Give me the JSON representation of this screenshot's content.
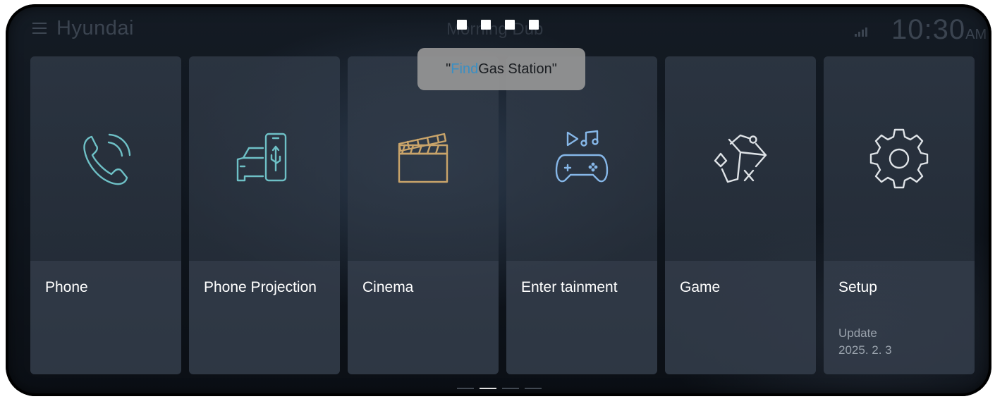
{
  "topbar": {
    "brand": "Hyundai",
    "center_text": "Morning Dub",
    "clock_time": "10:30",
    "clock_ampm": "AM",
    "signal_label": "Rall"
  },
  "voice": {
    "quote_open": "\"",
    "highlight": "Find",
    "rest": " Gas Station ",
    "quote_close": "\""
  },
  "cards": [
    {
      "label": "Phone",
      "icon": "phone-call-icon",
      "color": "#6ec0c6"
    },
    {
      "label": "Phone Projection",
      "icon": "phone-projection-icon",
      "color": "#6ec0c6"
    },
    {
      "label": "Cinema",
      "icon": "clapperboard-icon",
      "color": "#c9a46a"
    },
    {
      "label": "Enter tainment",
      "icon": "entertainment-icon",
      "color": "#86b7e8"
    },
    {
      "label": "Game",
      "icon": "game-cube-icon",
      "color": "#dfe3e7"
    },
    {
      "label": "Setup",
      "icon": "gear-icon",
      "color": "#dfe3e7",
      "sub_line1": "Update",
      "sub_line2": "2025. 2. 3"
    }
  ],
  "pager": {
    "pages": 4,
    "active": 2
  }
}
